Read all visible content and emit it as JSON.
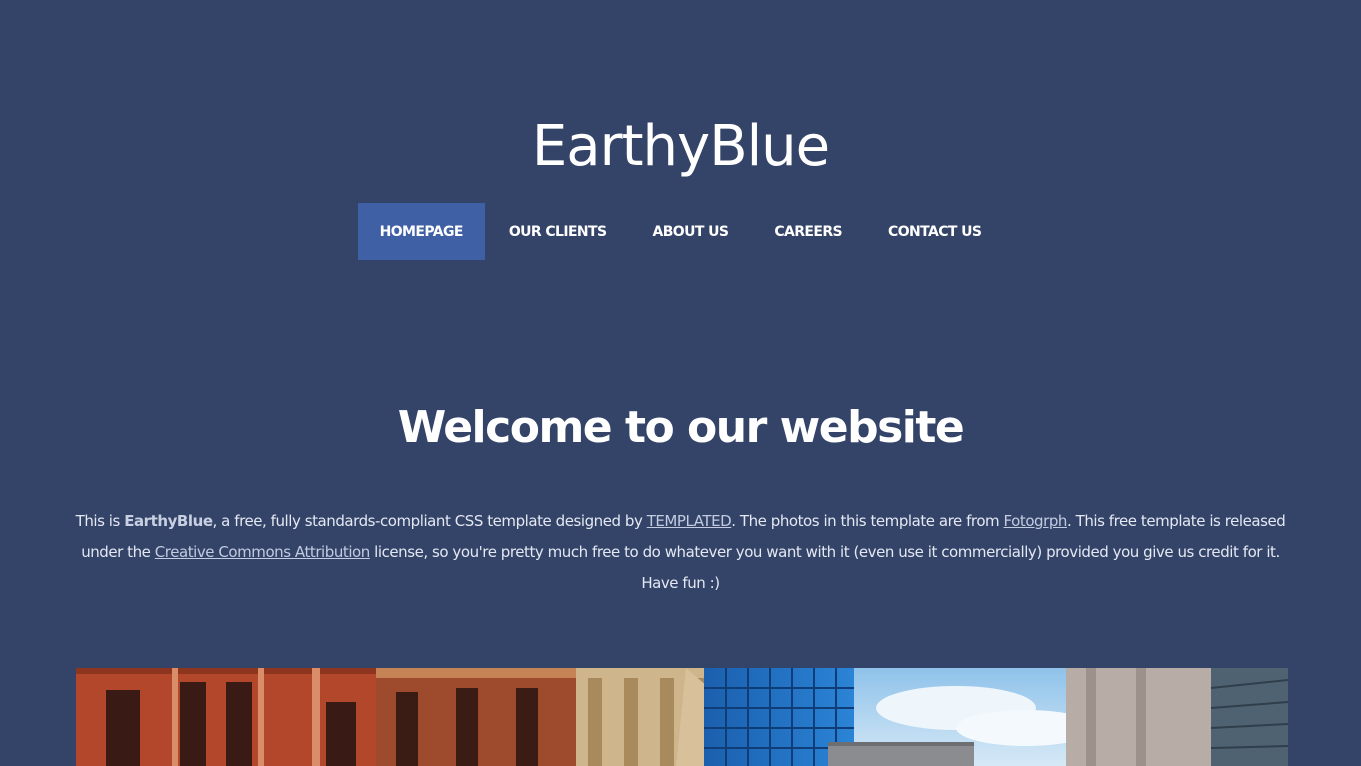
{
  "site": {
    "title": "EarthyBlue"
  },
  "nav": {
    "items": [
      {
        "label": "HOMEPAGE",
        "active": true
      },
      {
        "label": "OUR CLIENTS",
        "active": false
      },
      {
        "label": "ABOUT US",
        "active": false
      },
      {
        "label": "CAREERS",
        "active": false
      },
      {
        "label": "CONTACT US",
        "active": false
      }
    ]
  },
  "main": {
    "heading": "Welcome to our website",
    "intro": {
      "t1": "This is ",
      "brand": "EarthyBlue",
      "t2": ", a free, fully standards-compliant CSS template designed by ",
      "link1": "TEMPLATED",
      "t3": ". The photos in this template are from ",
      "link2": "Fotogrph",
      "t4": ". This free template is released under the ",
      "link3": "Creative Commons Attribution",
      "t5": " license, so you're pretty much free to do whatever you want with it (even use it commercially) provided you give us credit for it. Have fun :)"
    }
  },
  "colors": {
    "background": "#344468",
    "nav_active": "#4060a6",
    "text": "#ffffff",
    "link": "#c3cbe0"
  }
}
